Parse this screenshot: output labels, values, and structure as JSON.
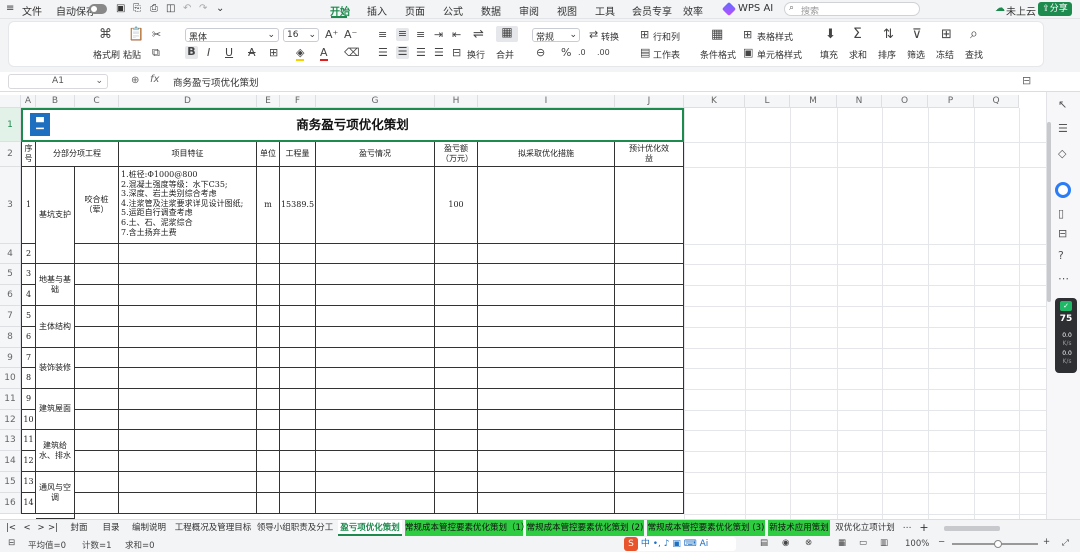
{
  "menu": {
    "file": "文件",
    "autosave": "自动保存",
    "tabs": [
      "开始",
      "插入",
      "页面",
      "公式",
      "数据",
      "审阅",
      "视图",
      "工具",
      "会员专享",
      "效率"
    ],
    "wps_ai": "WPS AI",
    "search_placeholder": "搜索",
    "cloud": "未上云",
    "share": "分享"
  },
  "ribbon": {
    "format_painter": "格式刷",
    "paste": "粘贴",
    "font_name": "黑体",
    "font_size": "16",
    "number_format": "常规",
    "convert": "转换",
    "rows_cols": "行和列",
    "wrap": "换行",
    "merge": "合并",
    "worksheet": "工作表",
    "cond_format": "条件格式",
    "table_style": "表格样式",
    "cell_style": "单元格样式",
    "fill": "填充",
    "sum": "求和",
    "sort": "排序",
    "filter": "筛选",
    "freeze": "冻结",
    "find": "查找",
    "percent": "%"
  },
  "formula": {
    "cell_ref": "A1",
    "fx": "fx",
    "content": "商务盈亏项优化策划"
  },
  "columns": [
    "A",
    "B",
    "C",
    "D",
    "E",
    "F",
    "G",
    "H",
    "I",
    "J",
    "K",
    "L",
    "M",
    "N",
    "O",
    "P",
    "Q"
  ],
  "rows": [
    "1",
    "2",
    "3",
    "4",
    "5",
    "6",
    "7",
    "8",
    "9",
    "10",
    "11",
    "12",
    "13",
    "14",
    "15",
    "16"
  ],
  "sheet": {
    "title": "商务盈亏项优化策划",
    "headers": {
      "seq": "序号",
      "part": "分部分项工程",
      "feature": "项目特征",
      "unit": "单位",
      "qty": "工程量",
      "profit": "盈亏情况",
      "amount": "盈亏额（万元）",
      "measure": "拟采取优化措施",
      "expected": "预计优化效益"
    },
    "row3": {
      "seq": "1",
      "part": "基坑支护",
      "sub": "咬合桩（荤）",
      "features": [
        "1.桩径:Φ1000@800",
        "2.混凝土强度等级：水下C35;",
        "3.深度、岩土类别综合考虑",
        "4.注浆管及注浆要求详见设计图纸;",
        "5.运距自行调查考虑",
        "6.土、石、泥浆综合",
        "7.含土扬弃土费"
      ],
      "unit": "m",
      "qty": "15389.5",
      "amount": "100"
    },
    "seqs": [
      "2",
      "3",
      "4",
      "5",
      "6",
      "7",
      "8",
      "9",
      "10",
      "11",
      "12",
      "13",
      "14"
    ],
    "groups": [
      "地基与基础",
      "主体结构",
      "装饰装修",
      "建筑屋面",
      "建筑给水、排水",
      "通风与空调"
    ]
  },
  "sheet_tabs": [
    "封面",
    "目录",
    "编制说明",
    "工程概况及管理目标",
    "领导小组职责及分工",
    "盈亏项优化策划",
    "常规成本管控要素优化策划（1）",
    "常规成本管控要素优化策划 (2)",
    "常规成本管控要素优化策划 (3)",
    "新技术应用策划",
    "双优化立项计划"
  ],
  "status": {
    "avg": "平均值=0",
    "count": "计数=1",
    "sum": "求和=0",
    "zoom": "100%"
  },
  "side": {
    "score": "75",
    "up": "0.0",
    "up_unit": "K/s",
    "down": "0.0",
    "down_unit": "K/s"
  },
  "colors": {
    "accent": "#1d8a4e",
    "green_tab": "#2ecc40",
    "active_tab": "#ffffff"
  }
}
